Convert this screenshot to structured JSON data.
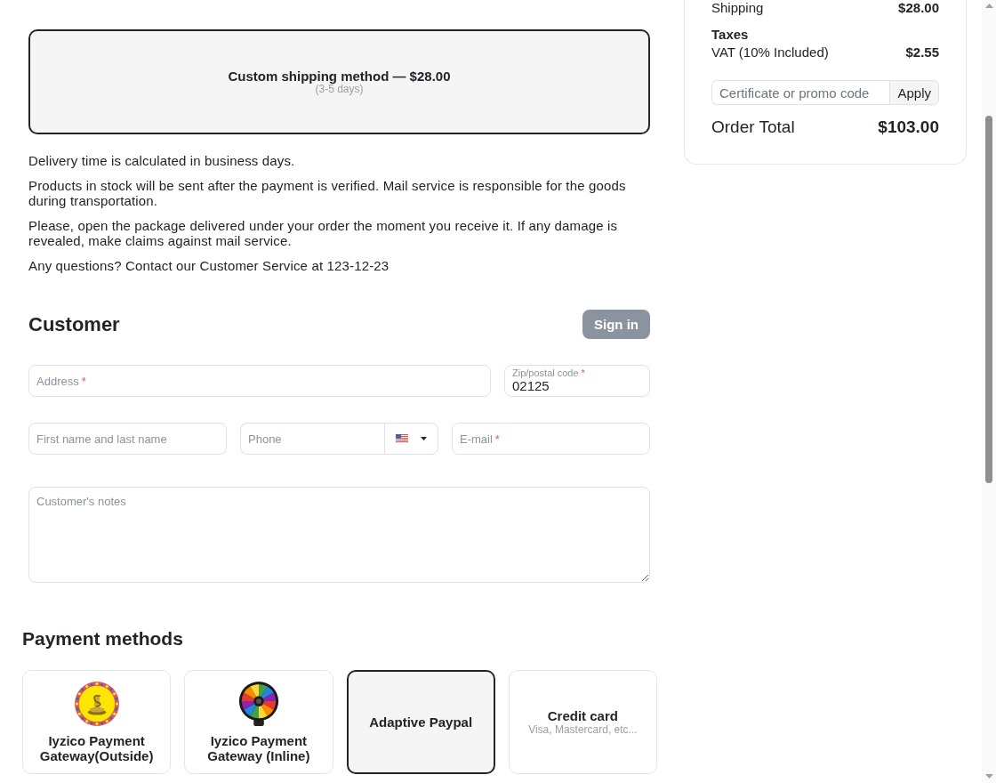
{
  "order_summary": {
    "rows": [
      {
        "label": "Shipping",
        "value": "$28.00"
      }
    ],
    "taxes": {
      "title": "Taxes",
      "rows": [
        {
          "label": "VAT (10% Included)",
          "value": "$2.55"
        }
      ]
    },
    "promo": {
      "placeholder": "Certificate or promo code",
      "button": "Apply"
    },
    "total": {
      "label": "Order Total",
      "value": "$103.00"
    }
  },
  "shipping_methods": [
    {
      "title": "Custom shipping method — $28.00",
      "subtitle": "(3-5 days)",
      "selected": true
    }
  ],
  "delivery_notes": [
    "Delivery time is calculated in business days.",
    "Products in stock will be sent after the payment is verified. Mail service is responsible for the goods during transportation.",
    "Please, open the package delivered under your order the moment you receive it. If any damage is revealed, make claims against mail service.",
    "Any questions? Contact our Customer Service at 123-12-23"
  ],
  "customer": {
    "title": "Customer",
    "sign_in_button": "Sign in",
    "rows": [
      [
        {
          "kind": "text",
          "placeholder": "Address",
          "required_mark": "*"
        },
        {
          "kind": "text",
          "label": "Zip/postal code",
          "required_mark": "*",
          "value": "02125"
        }
      ],
      [
        {
          "kind": "text",
          "placeholder": "First name and last name"
        },
        {
          "kind": "phone",
          "placeholder": "Phone"
        },
        {
          "kind": "text",
          "placeholder": "E-mail",
          "required_mark": "*"
        }
      ],
      [
        {
          "kind": "notes",
          "placeholder": "Customer's notes"
        }
      ]
    ]
  },
  "payment_methods": {
    "title": "Payment methods",
    "methods": [
      {
        "kind": "coin",
        "name": "Iyzico Payment Gateway(Outside)",
        "selected": false
      },
      {
        "kind": "wheel",
        "name": "Iyzico Payment Gateway (Inline)",
        "selected": false
      },
      {
        "kind": "text",
        "name": "Adaptive Paypal",
        "selected": true
      },
      {
        "kind": "text",
        "name": "Credit card",
        "subtitle": "Visa, Mastercard, etc...",
        "selected": false
      }
    ]
  }
}
